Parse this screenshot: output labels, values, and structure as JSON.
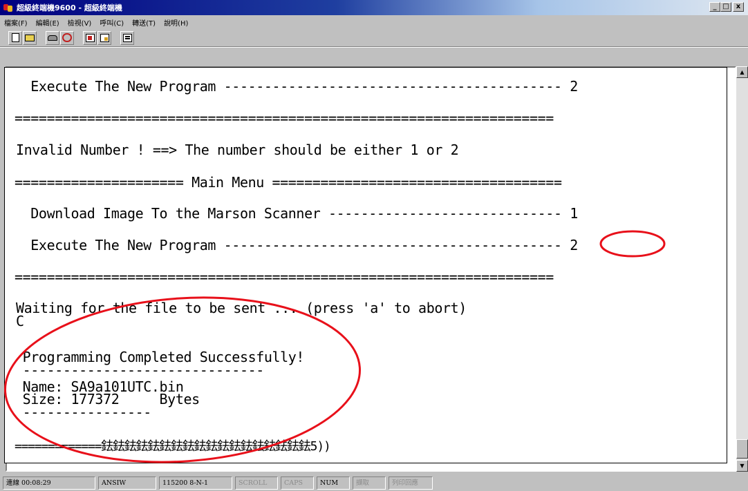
{
  "window": {
    "title": "超級終端機9600 - 超級終端機",
    "minimize": "_",
    "maximize": "□",
    "close": "x"
  },
  "menu": [
    "檔案(F)",
    "編輯(E)",
    "檢視(V)",
    "呼叫(C)",
    "轉送(T)",
    "說明(H)"
  ],
  "toolbar_icons": [
    "new-icon",
    "open-icon",
    "call-icon",
    "hang-up-icon",
    "send-icon",
    "receive-icon",
    "properties-icon"
  ],
  "terminal": {
    "lines": [
      "  Execute The New Program ------------------------------------------ 2",
      "===================================================================",
      "Invalid Number ! ==> The number should be either 1 or 2",
      "===================== Main Menu ====================================",
      "  Download Image To the Marson Scanner ----------------------------- 1",
      "  Execute The New Program ------------------------------------------ 2",
      "===================================================================",
      "Waiting for the file to be sent ... (press 'a' to abort)",
      "C",
      " Programming Completed Successfully!",
      " ------------------------------",
      " Name: SA9a101UTC.bin",
      " Size: 177372     Bytes",
      " ----------------",
      "=============鉣鉣鉣鉣鉣鉣鉣鉣鉣鉣鉣鉣鉣鉣鉣鉣鉣鉣5))"
    ]
  },
  "annotation_color": "#e8101a",
  "status": {
    "connected": "連線 00:08:29",
    "emulation": "ANSIW",
    "settings": "115200 8-N-1",
    "scroll": "SCROLL",
    "caps": "CAPS",
    "num": "NUM",
    "capture": "擷取",
    "print_echo": "列印回應"
  }
}
